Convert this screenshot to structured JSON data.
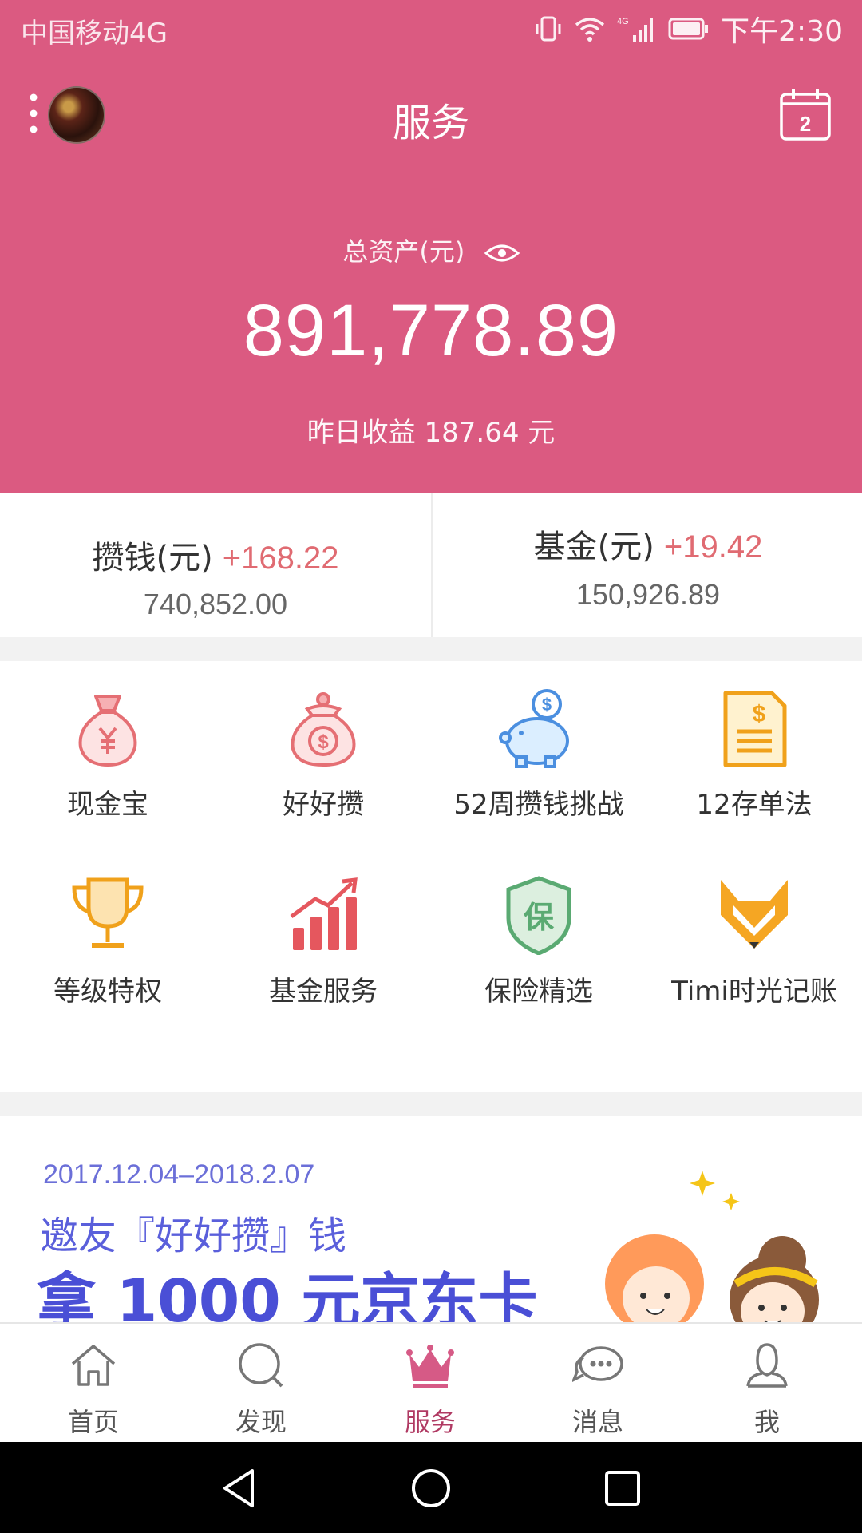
{
  "status_bar": {
    "carrier": "中国移动4G",
    "time": "下午2:30",
    "network_tag": "4G"
  },
  "header": {
    "title": "服务",
    "calendar_day": "2",
    "total_label": "总资产(元)",
    "total_value": "891,778.89",
    "yesterday_label": "昨日收益 187.64 元"
  },
  "accounts": [
    {
      "title": "攒钱(元)",
      "change": "+168.22",
      "value": "740,852.00"
    },
    {
      "title": "基金(元)",
      "change": "+19.42",
      "value": "150,926.89"
    }
  ],
  "services": [
    {
      "label": "现金宝",
      "icon": "money-bag-yen-icon"
    },
    {
      "label": "好好攒",
      "icon": "money-bag-dollar-icon"
    },
    {
      "label": "52周攒钱挑战",
      "icon": "piggy-bank-icon"
    },
    {
      "label": "12存单法",
      "icon": "certificate-icon"
    },
    {
      "label": "等级特权",
      "icon": "trophy-icon"
    },
    {
      "label": "基金服务",
      "icon": "growth-chart-icon"
    },
    {
      "label": "保险精选",
      "icon": "insurance-shield-icon"
    },
    {
      "label": "Timi时光记账",
      "icon": "fox-icon"
    }
  ],
  "banner": {
    "date_range": "2017.12.04–2018.2.07",
    "line1": "邀友『好好攒』钱",
    "line2": "拿 1000 元京东卡"
  },
  "tabs": [
    {
      "label": "首页",
      "icon": "home-icon"
    },
    {
      "label": "发现",
      "icon": "search-icon"
    },
    {
      "label": "服务",
      "icon": "crown-icon",
      "active": true
    },
    {
      "label": "消息",
      "icon": "chat-bubbles-icon"
    },
    {
      "label": "我",
      "icon": "user-icon"
    }
  ],
  "colors": {
    "header_bg": "#db5a81",
    "positive_change": "#e06b72",
    "active_tab": "#b03a63",
    "banner_text": "#4a4fd6"
  }
}
